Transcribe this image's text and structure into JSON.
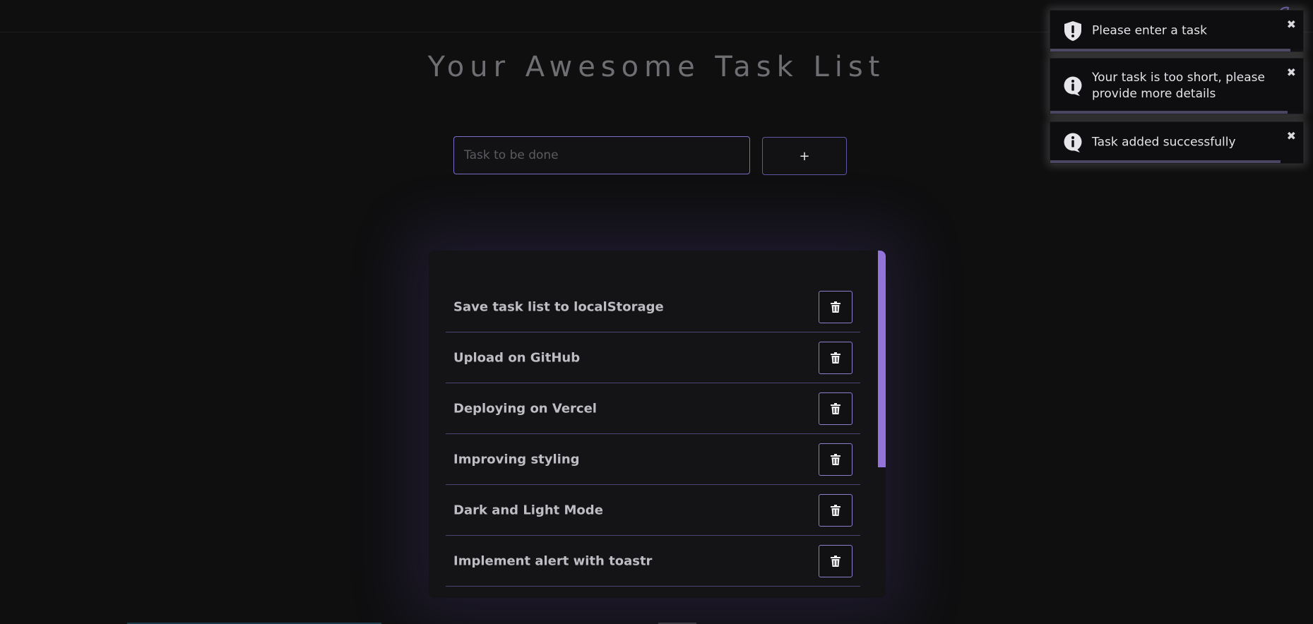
{
  "app": {
    "title": "Your Awesome Task List"
  },
  "form": {
    "input_placeholder": "Task to be done",
    "input_value": "",
    "add_label": "+"
  },
  "tasks": [
    {
      "text": "Save task list to localStorage",
      "delete_icon": "trash-icon"
    },
    {
      "text": "Upload on GitHub",
      "delete_icon": "trash-icon"
    },
    {
      "text": "Deploying on Vercel",
      "delete_icon": "trash-icon"
    },
    {
      "text": "Improving styling",
      "delete_icon": "trash-icon"
    },
    {
      "text": "Dark and Light Mode",
      "delete_icon": "trash-icon"
    },
    {
      "text": "Implement alert with toastr",
      "delete_icon": "trash-icon"
    }
  ],
  "toasts": [
    {
      "type": "warning",
      "icon": "shield-icon",
      "message": "Please enter a task",
      "close": "✖"
    },
    {
      "type": "info",
      "icon": "info-icon",
      "message": "Your task is too short, please provide more details",
      "close": "✖"
    },
    {
      "type": "info",
      "icon": "info-icon",
      "message": "Task added successfully",
      "close": "✖"
    }
  ],
  "theme_toggle": {
    "icon": "moon-icon"
  },
  "colors": {
    "background": "#0f0f10",
    "accent": "#9274db",
    "border_accent": "#7b6cc6",
    "text": "#bdbdc3"
  }
}
